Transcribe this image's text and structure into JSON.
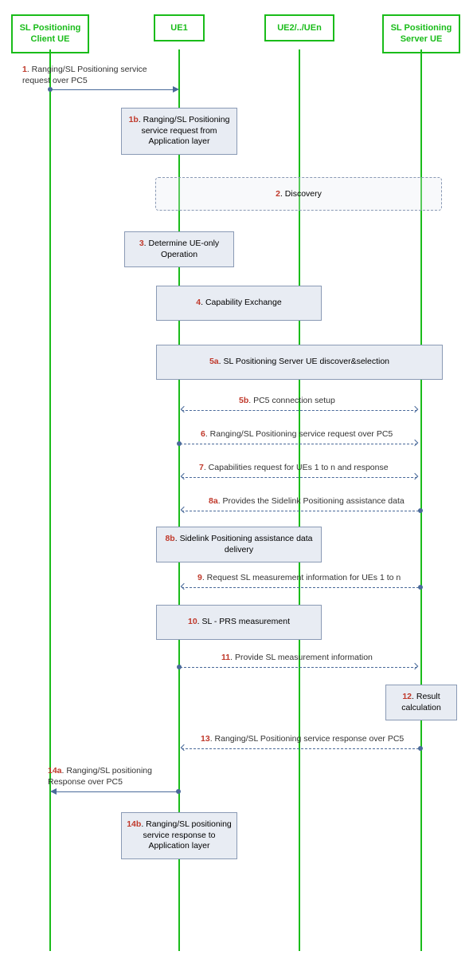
{
  "participants": {
    "client": "SL Positioning Client UE",
    "ue1": "UE1",
    "uen": "UE2/../UEn",
    "server": "SL Positioning Server UE"
  },
  "steps": {
    "s1": {
      "num": "1",
      "text": ". Ranging/SL Positioning service request over PC5"
    },
    "s1b": {
      "num": "1b",
      "text": ". Ranging/SL Positioning service request from Application layer"
    },
    "s2": {
      "num": "2",
      "text": ". Discovery"
    },
    "s3": {
      "num": "3",
      "text": ". Determine UE-only Operation"
    },
    "s4": {
      "num": "4",
      "text": ". Capability Exchange"
    },
    "s5a": {
      "num": "5a",
      "text": ". SL Positioning Server UE discover&selection"
    },
    "s5b": {
      "num": "5b",
      "text": ". PC5 connection setup"
    },
    "s6": {
      "num": "6",
      "text": ". Ranging/SL Positioning service request over PC5"
    },
    "s7": {
      "num": "7",
      "text": ". Capabilities request for UEs 1 to n and response"
    },
    "s8a": {
      "num": "8a",
      "text": ". Provides the Sidelink Positioning assistance data"
    },
    "s8b": {
      "num": "8b",
      "text": ". Sidelink Positioning assistance data delivery"
    },
    "s9": {
      "num": "9",
      "text": ". Request SL measurement information for UEs 1 to n"
    },
    "s10": {
      "num": "10",
      "text": ". SL - PRS measurement"
    },
    "s11": {
      "num": "11",
      "text": ". Provide SL measurement information"
    },
    "s12": {
      "num": "12",
      "text": ". Result calculation"
    },
    "s13": {
      "num": "13",
      "text": ". Ranging/SL Positioning service response over PC5"
    },
    "s14a": {
      "num": "14a",
      "text": ". Ranging/SL positioning Response over PC5"
    },
    "s14b": {
      "num": "14b",
      "text": ". Ranging/SL positioning service response to Application layer"
    }
  }
}
